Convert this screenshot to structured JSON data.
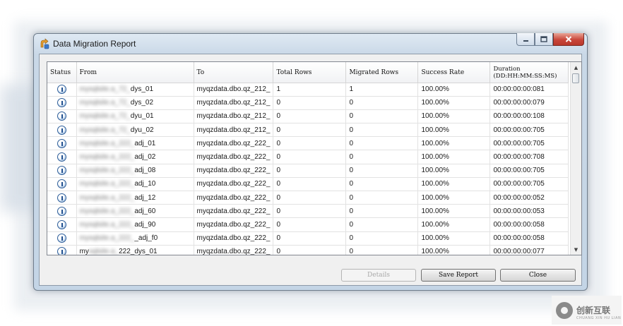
{
  "window": {
    "title": "Data Migration Report",
    "icon": "migration-app-icon",
    "caption_buttons": [
      "minimize",
      "maximize",
      "close"
    ]
  },
  "grid": {
    "columns": [
      "Status",
      "From",
      "To",
      "Total Rows",
      "Migrated Rows",
      "Success Rate",
      "Duration\n(DD:HH:MM:SS:MS)"
    ],
    "rows": [
      {
        "status_icon": "info-icon",
        "from_hidden": "mysqlsite.a_72_",
        "from": "dys_01",
        "to": "myqzdata.dbo.qz_212_",
        "total": "1",
        "migrated": "1",
        "rate": "100.00%",
        "duration": "00:00:00:00:081"
      },
      {
        "status_icon": "info-icon",
        "from_hidden": "mysqlsite.a_72_",
        "from": "dys_02",
        "to": "myqzdata.dbo.qz_212_",
        "total": "0",
        "migrated": "0",
        "rate": "100.00%",
        "duration": "00:00:00:00:079"
      },
      {
        "status_icon": "info-icon",
        "from_hidden": "mysqlsite.a_72_",
        "from": "dyu_01",
        "to": "myqzdata.dbo.qz_212_",
        "total": "0",
        "migrated": "0",
        "rate": "100.00%",
        "duration": "00:00:00:00:108"
      },
      {
        "status_icon": "info-icon",
        "from_hidden": "mysqlsite.a_72_",
        "from": "dyu_02",
        "to": "myqzdata.dbo.qz_212_",
        "total": "0",
        "migrated": "0",
        "rate": "100.00%",
        "duration": "00:00:00:00:705"
      },
      {
        "status_icon": "info-icon",
        "from_hidden": "mysqlsite.a_222_",
        "from": "adj_01",
        "to": "myqzdata.dbo.qz_222_",
        "total": "0",
        "migrated": "0",
        "rate": "100.00%",
        "duration": "00:00:00:00:705"
      },
      {
        "status_icon": "info-icon",
        "from_hidden": "mysqlsite.a_222_",
        "from": "adj_02",
        "to": "myqzdata.dbo.qz_222_",
        "total": "0",
        "migrated": "0",
        "rate": "100.00%",
        "duration": "00:00:00:00:708"
      },
      {
        "status_icon": "info-icon",
        "from_hidden": "mysqlsite.a_222_",
        "from": "adj_08",
        "to": "myqzdata.dbo.qz_222_",
        "total": "0",
        "migrated": "0",
        "rate": "100.00%",
        "duration": "00:00:00:00:705"
      },
      {
        "status_icon": "info-icon",
        "from_hidden": "mysqlsite.a_222_",
        "from": "adj_10",
        "to": "myqzdata.dbo.qz_222_",
        "total": "0",
        "migrated": "0",
        "rate": "100.00%",
        "duration": "00:00:00:00:705"
      },
      {
        "status_icon": "info-icon",
        "from_hidden": "mysqlsite.a_222_",
        "from": "adj_12",
        "to": "myqzdata.dbo.qz_222_",
        "total": "0",
        "migrated": "0",
        "rate": "100.00%",
        "duration": "00:00:00:00:052"
      },
      {
        "status_icon": "info-icon",
        "from_hidden": "mysqlsite.a_222_",
        "from": "adj_60",
        "to": "myqzdata.dbo.qz_222_",
        "total": "0",
        "migrated": "0",
        "rate": "100.00%",
        "duration": "00:00:00:00:053"
      },
      {
        "status_icon": "info-icon",
        "from_hidden": "mysqlsite.a_222_",
        "from": "adj_90",
        "to": "myqzdata.dbo.qz_222_",
        "total": "0",
        "migrated": "0",
        "rate": "100.00%",
        "duration": "00:00:00:00:058"
      },
      {
        "status_icon": "info-icon",
        "from_hidden": "mysqlsite.a_222_",
        "from": "_adj_f0",
        "to": "myqzdata.dbo.qz_222_",
        "total": "0",
        "migrated": "0",
        "rate": "100.00%",
        "duration": "00:00:00:00:058"
      },
      {
        "status_icon": "info-icon",
        "from_hidden": "my",
        "from_hidden2": "sqlsite.a_",
        "from": "222_dys_01",
        "to": "myqzdata.dbo.qz_222_",
        "total": "0",
        "migrated": "0",
        "rate": "100.00%",
        "duration": "00:00:00:00:077"
      }
    ]
  },
  "buttons": {
    "details": "Details",
    "save_report": "Save Report",
    "close": "Close"
  },
  "watermark": {
    "text": "创新互联",
    "sub": "CHUANG XIN HU LIAN"
  }
}
